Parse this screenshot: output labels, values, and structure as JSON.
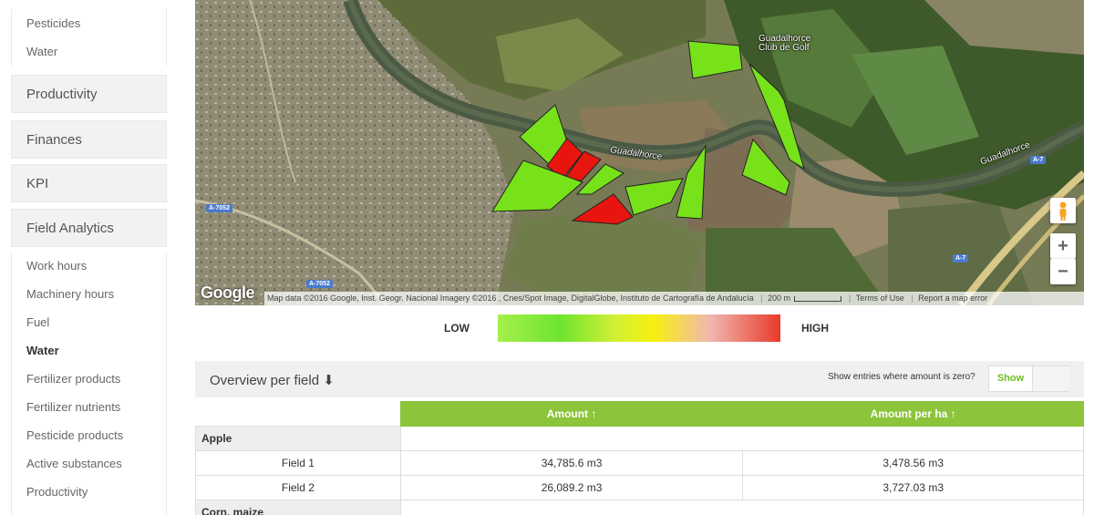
{
  "sidebar": {
    "top_items": [
      "Pesticides",
      "Water"
    ],
    "sections": [
      "Productivity",
      "Finances",
      "KPI",
      "Field Analytics"
    ],
    "field_analytics_items": [
      "Work hours",
      "Machinery hours",
      "Fuel",
      "Water",
      "Fertilizer products",
      "Fertilizer nutrients",
      "Pesticide products",
      "Active substances",
      "Productivity"
    ],
    "active_item": "Water"
  },
  "map": {
    "labels": {
      "river_1": "Guadalhorce",
      "river_2": "Guadalhorce",
      "golf": "Guadalhorce Club de Golf",
      "road_a7052_1": "A-7052",
      "road_a7052_2": "A-7052",
      "road_a7_1": "A-7",
      "road_a7_2": "A-7"
    },
    "google_logo": "Google",
    "attribution": "Map data ©2016 Google, Inst. Geogr. Nacional Imagery ©2016 , Cnes/Spot Image, DigitalGlobe, Instituto de Cartografía de Andalucía",
    "scale_label": "200 m",
    "terms": "Terms of Use",
    "report": "Report a map error",
    "zoom_in": "+",
    "zoom_out": "−"
  },
  "legend": {
    "low": "LOW",
    "high": "HIGH",
    "colors": {
      "low": "#7ee832",
      "mid": "#f6f00f",
      "high": "#e83a2a"
    }
  },
  "overview": {
    "title": "Overview per field ⬇",
    "zero_label": "Show entries where amount is zero?",
    "toggle_label": "Show"
  },
  "table": {
    "headers": [
      "Amount ↑",
      "Amount per ha ↑"
    ],
    "groups": [
      {
        "name": "Apple",
        "rows": [
          {
            "field": "Field 1",
            "amount": "34,785.6 m3",
            "per_ha": "3,478.56 m3"
          },
          {
            "field": "Field 2",
            "amount": "26,089.2 m3",
            "per_ha": "3,727.03 m3"
          }
        ]
      },
      {
        "name": "Corn, maize",
        "rows": []
      }
    ]
  },
  "colors": {
    "accent": "#8cc43c",
    "field_high": "#e8150f",
    "field_low": "#7ee61c"
  }
}
